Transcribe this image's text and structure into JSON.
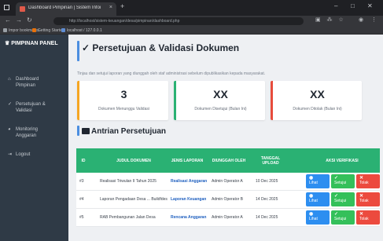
{
  "browser": {
    "tab_title": "Dashboard Pimpinan | Sistem Infor...",
    "tab_close": "×",
    "new_tab": "+",
    "win_min": "–",
    "win_max": "□",
    "win_close": "✕",
    "url": "http://localhost/sistem-keuangan/desa/pimpinan/dashboard.php",
    "nav_back": "←",
    "nav_forward": "→",
    "nav_reload": "↻",
    "bookmarks": [
      {
        "label": "Impor bookmarks",
        "color": "#9aa0a6"
      },
      {
        "label": "Getting Started",
        "color": "#e8710a"
      },
      {
        "label": "localhost / 127.0.0.1",
        "color": "#5f8dd3"
      }
    ]
  },
  "sidebar": {
    "brand": "PIMPINAN PANEL",
    "brand_icon": "crown-icon",
    "items": [
      {
        "icon": "home-icon",
        "glyph": "⌂",
        "line1": "Dashboard",
        "line2": "Pimpinan"
      },
      {
        "icon": "check-icon",
        "glyph": "✓",
        "line1": "Persetujuan &",
        "line2": "Validasi"
      },
      {
        "icon": "chart-icon",
        "glyph": "◕",
        "line1": "Monitoring",
        "line2": "Anggaran"
      },
      {
        "icon": "logout-icon",
        "glyph": "⇥",
        "line1": "Logout",
        "line2": ""
      }
    ]
  },
  "main": {
    "title": "✓ Persetujuan & Validasi Dokumen",
    "description": "Tinjau dan setujui laporan yang diunggah oleh staf administrasi sebelum dipublikasikan kepada masyarakat.",
    "cards": [
      {
        "value": "3",
        "label": "Dokumen Menunggu Validasi",
        "color": "#f5a623"
      },
      {
        "value": "XX",
        "label": "Dokumen Disetujui (Bulan Ini)",
        "color": "#2ab173"
      },
      {
        "value": "XX",
        "label": "Dokumen Ditolak (Bulan Ini)",
        "color": "#e74c3c"
      }
    ],
    "section_title": "Antrian Persetujuan",
    "table": {
      "headers": [
        "ID",
        "JUDUL DOKUMEN",
        "JENIS LAPORAN",
        "DIUNGGAH OLEH",
        "TANGGAL UPLOAD",
        "AKSI VERIFIKASI"
      ],
      "actions": {
        "view": "Lihat",
        "approve": "Setujui",
        "reject": "Tolak"
      },
      "rows": [
        {
          "id": "#3",
          "title": "Realisasi Triwulan II Tahun 2025",
          "type": "Realisasi Anggaran",
          "by": "Admin Operator A",
          "date": "10 Dec 2025"
        },
        {
          "id": "#4",
          "title": "Laporan Pengadaan Desa ... Buildfdes",
          "type": "Laporan Keuangan",
          "by": "Admin Operator B",
          "date": "14 Dec 2025"
        },
        {
          "id": "#5",
          "title": "RAB Pembangunan Jalan Desa",
          "type": "Rencana Anggaran",
          "by": "Admin Operator A",
          "date": "14 Dec 2025"
        }
      ]
    }
  }
}
